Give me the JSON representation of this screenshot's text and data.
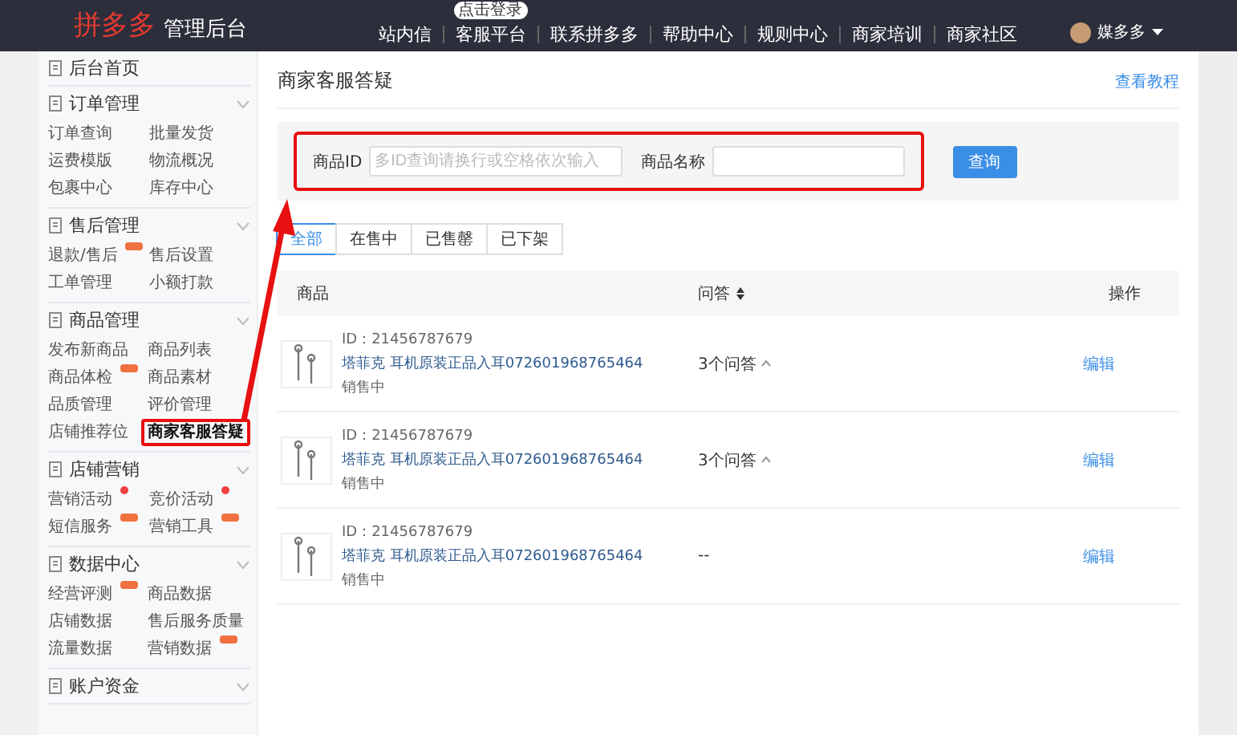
{
  "topbar": {
    "logo": "拼多多",
    "subtitle": "管理后台",
    "nav": [
      {
        "label": "站内信"
      },
      {
        "label": "客服平台",
        "badge": "点击登录"
      },
      {
        "label": "联系拼多多"
      },
      {
        "label": "帮助中心"
      },
      {
        "label": "规则中心"
      },
      {
        "label": "商家培训"
      },
      {
        "label": "商家社区"
      }
    ],
    "user": "媒多多"
  },
  "sidebar": [
    {
      "title": "后台首页"
    },
    {
      "title": "订单管理",
      "expandable": true,
      "items": [
        {
          "label": "订单查询",
          "selected": false,
          "highlighted": false
        },
        {
          "label": "批量发货",
          "selected": false,
          "highlighted": false
        },
        {
          "label": "运费模版",
          "selected": false,
          "highlighted": false
        },
        {
          "label": "物流概况",
          "selected": false,
          "highlighted": false
        },
        {
          "label": "包裹中心",
          "selected": false,
          "highlighted": false
        },
        {
          "label": "库存中心",
          "selected": false,
          "highlighted": false
        }
      ]
    },
    {
      "title": "售后管理",
      "expandable": true,
      "items": [
        {
          "label": "退款/售后",
          "new_tag": true,
          "selected": false,
          "highlighted": false
        },
        {
          "label": "售后设置",
          "selected": false,
          "highlighted": false
        },
        {
          "label": "工单管理",
          "selected": false,
          "highlighted": false
        },
        {
          "label": "小额打款",
          "selected": false,
          "highlighted": false
        }
      ]
    },
    {
      "title": "商品管理",
      "expandable": true,
      "items": [
        {
          "label": "发布新商品",
          "selected": false,
          "highlighted": false
        },
        {
          "label": "商品列表",
          "selected": false,
          "highlighted": false
        },
        {
          "label": "商品体检",
          "new_tag": true,
          "selected": false,
          "highlighted": false
        },
        {
          "label": "商品素材",
          "selected": false,
          "highlighted": false
        },
        {
          "label": "品质管理",
          "selected": false,
          "highlighted": false
        },
        {
          "label": "评价管理",
          "selected": false,
          "highlighted": false
        },
        {
          "label": "店铺推荐位",
          "selected": false,
          "highlighted": false
        },
        {
          "label": "商家客服答疑",
          "selected": true,
          "highlighted": true
        }
      ]
    },
    {
      "title": "店铺营销",
      "expandable": true,
      "items": [
        {
          "label": "营销活动",
          "dot": true,
          "selected": false,
          "highlighted": false
        },
        {
          "label": "竞价活动",
          "dot": true,
          "selected": false,
          "highlighted": false
        },
        {
          "label": "短信服务",
          "new_tag": true,
          "selected": false,
          "highlighted": false
        },
        {
          "label": "营销工具",
          "new_tag": true,
          "selected": false,
          "highlighted": false
        }
      ]
    },
    {
      "title": "数据中心",
      "expandable": true,
      "items": [
        {
          "label": "经营评测",
          "new_tag": true,
          "selected": false,
          "highlighted": false
        },
        {
          "label": "商品数据",
          "selected": false,
          "highlighted": false
        },
        {
          "label": "店铺数据",
          "selected": false,
          "highlighted": false
        },
        {
          "label": "售后服务质量",
          "selected": false,
          "highlighted": false
        },
        {
          "label": "流量数据",
          "selected": false,
          "highlighted": false
        },
        {
          "label": "营销数据",
          "new_tag": true,
          "selected": false,
          "highlighted": false
        }
      ]
    },
    {
      "title": "账户资金",
      "expandable": true
    }
  ],
  "page": {
    "title": "商家客服答疑",
    "help_link": "查看教程"
  },
  "filter": {
    "highlighted": true,
    "fields": [
      {
        "label": "商品ID",
        "placeholder": "多ID查询请换行或空格依次输入"
      },
      {
        "label": "商品名称"
      }
    ],
    "button": "查询"
  },
  "tabs": [
    {
      "label": "全部",
      "selected": true
    },
    {
      "label": "在售中",
      "selected": false
    },
    {
      "label": "已售罄",
      "selected": false
    },
    {
      "label": "已下架",
      "selected": false
    }
  ],
  "table": {
    "columns": [
      "商品",
      "问答",
      "操作"
    ],
    "rows": [
      {
        "id": "ID：21456787679",
        "name": "塔菲克 耳机原装正品入耳072601968765464",
        "status": "销售中",
        "qa": "3个问答",
        "qa_expandable": true,
        "action": "编辑"
      },
      {
        "id": "ID：21456787679",
        "name": "塔菲克 耳机原装正品入耳072601968765464",
        "status": "销售中",
        "qa": "3个问答",
        "qa_expandable": true,
        "action": "编辑"
      },
      {
        "id": "ID：21456787679",
        "name": "塔菲克 耳机原装正品入耳072601968765464",
        "status": "销售中",
        "qa": "--",
        "action": "编辑"
      }
    ]
  }
}
